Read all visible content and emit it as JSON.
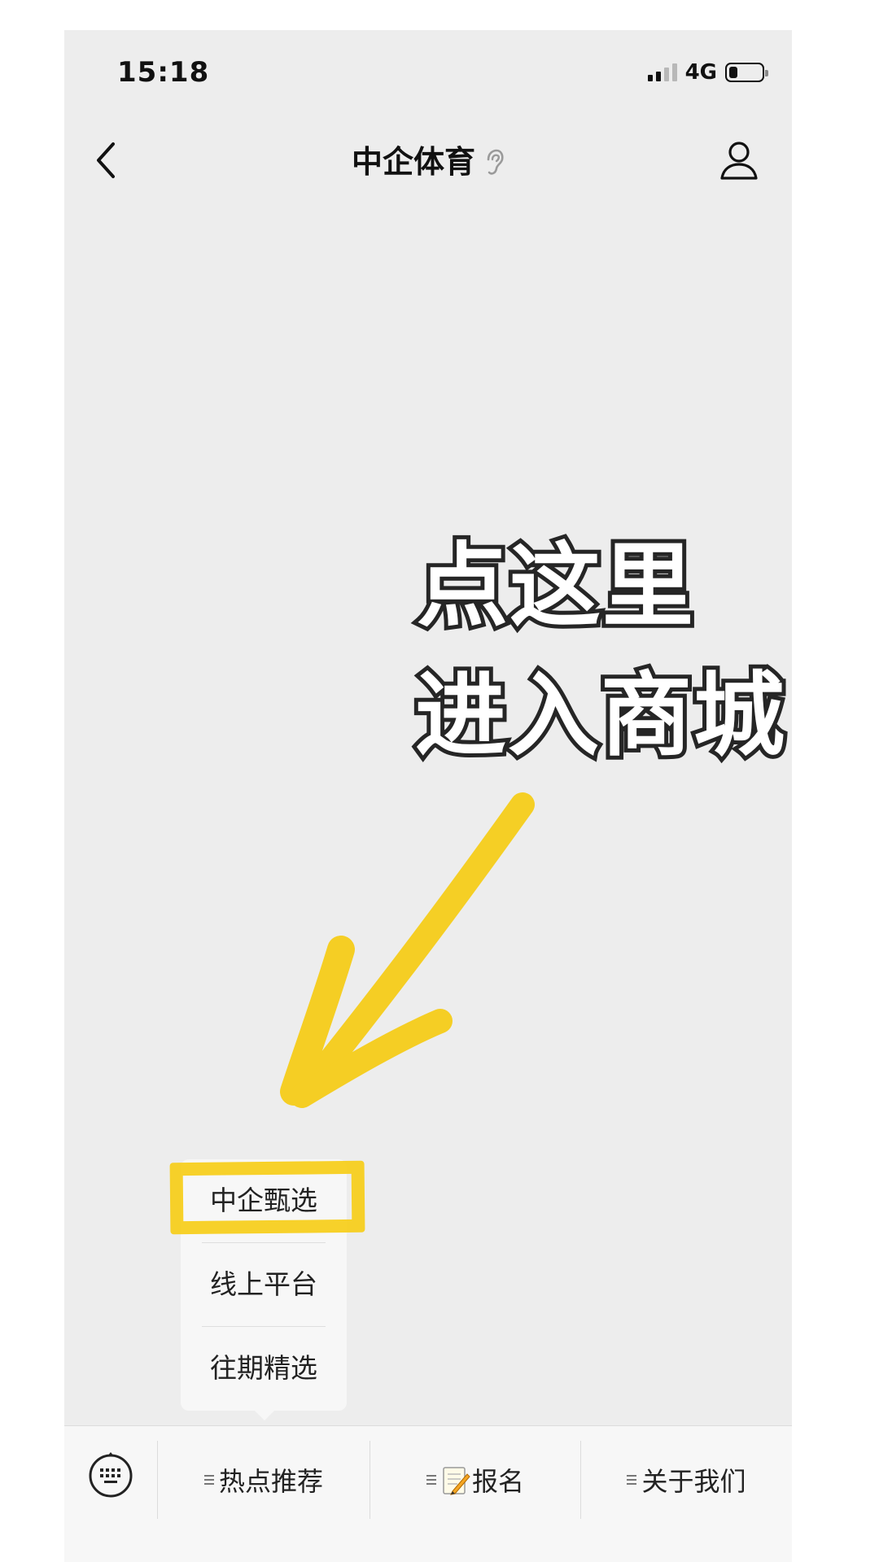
{
  "status_bar": {
    "time": "15:18",
    "network": "4G",
    "signal_bars": 2,
    "signal_total": 4,
    "battery_level": 0.25,
    "icons": [
      "signal-icon",
      "battery-icon"
    ]
  },
  "nav": {
    "back_icon": "chevron-left-icon",
    "title": "中企体育",
    "title_icon": "ear-icon",
    "profile_icon": "person-icon"
  },
  "annotation": {
    "line1": "点这里",
    "line2": "进入商城",
    "arrow_color": "#f6cd1a",
    "highlight_color": "#f6cd1a"
  },
  "submenu": {
    "items": [
      {
        "label": "中企甄选",
        "highlighted": true
      },
      {
        "label": "线上平台"
      },
      {
        "label": "往期精选"
      }
    ]
  },
  "menu_bar": {
    "keyboard_icon": "keyboard-icon",
    "items": [
      {
        "label": "热点推荐",
        "icon": "list-icon"
      },
      {
        "label": "报名",
        "icon": "memo-icon"
      },
      {
        "label": "关于我们",
        "icon": "list-icon"
      }
    ]
  },
  "colors": {
    "background": "#ededed",
    "menu_bar": "#f7f7f7",
    "annotation_stroke": "#262626"
  }
}
